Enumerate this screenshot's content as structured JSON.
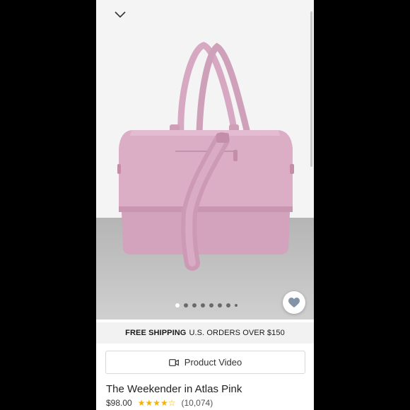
{
  "icons": {
    "collapse": "chevron-down-icon",
    "favorite": "heart-icon",
    "video": "video-camera-icon",
    "rating": "star-icon"
  },
  "carousel": {
    "slide_count": 8,
    "active_index": 0
  },
  "shipping": {
    "bold": "FREE SHIPPING",
    "rest": "U.S. ORDERS OVER $150"
  },
  "video_button": {
    "label": "Product Video"
  },
  "product": {
    "name": "The Weekender in Atlas Pink",
    "price": "$98.00",
    "rating": 4.5,
    "stars": "★★★★☆",
    "review_count": "(10,074)"
  },
  "colors": {
    "bag": "#dbaec6",
    "bag_dark": "#c996b1",
    "star": "#f5b300",
    "heart": "#8394a7"
  }
}
